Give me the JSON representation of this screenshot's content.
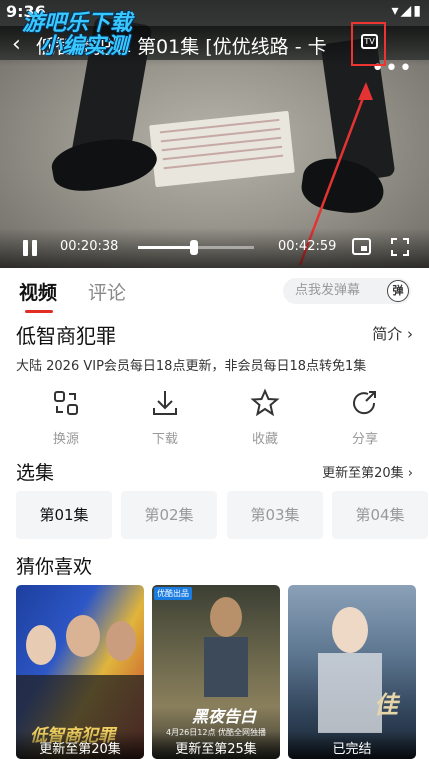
{
  "status_bar": {
    "time": "9:36"
  },
  "player": {
    "title": "低智商犯罪 第01集 [优优线路 - 卡",
    "watermark_line1": "游吧乐下载",
    "watermark_line2": "小编实测",
    "tv_label": "TV",
    "current_time": "00:20:38",
    "total_time": "00:42:59",
    "progress": 0.48
  },
  "tabs": [
    {
      "label": "视频"
    },
    {
      "label": "评论"
    }
  ],
  "danmu": {
    "placeholder": "点我发弹幕",
    "icon_label": "弹"
  },
  "show": {
    "title": "低智商犯罪",
    "intro_label": "简介 ›",
    "meta": "大陆  2026 VIP会员每日18点更新，非会员每日18点转免1集"
  },
  "actions": [
    {
      "label": "换源",
      "icon": "switch-source-icon"
    },
    {
      "label": "下载",
      "icon": "download-icon"
    },
    {
      "label": "收藏",
      "icon": "star-icon"
    },
    {
      "label": "分享",
      "icon": "share-icon"
    }
  ],
  "episodes": {
    "title": "选集",
    "update_text": "更新至第20集 ›",
    "items": [
      "第01集",
      "第02集",
      "第03集",
      "第04集"
    ],
    "active_index": 0
  },
  "recommend": {
    "title": "猜你喜欢",
    "items": [
      {
        "caption": "更新至第20集",
        "art_text": "低智商犯罪"
      },
      {
        "caption": "更新至第25集",
        "art_text": "黑夜告白",
        "date_text": "4月26日12点 优酷全网独播",
        "badge": "优酷出品"
      },
      {
        "caption": "已完结",
        "art_text": "佳"
      }
    ]
  },
  "colors": {
    "accent": "#e02e24",
    "annotation": "#e33333"
  }
}
